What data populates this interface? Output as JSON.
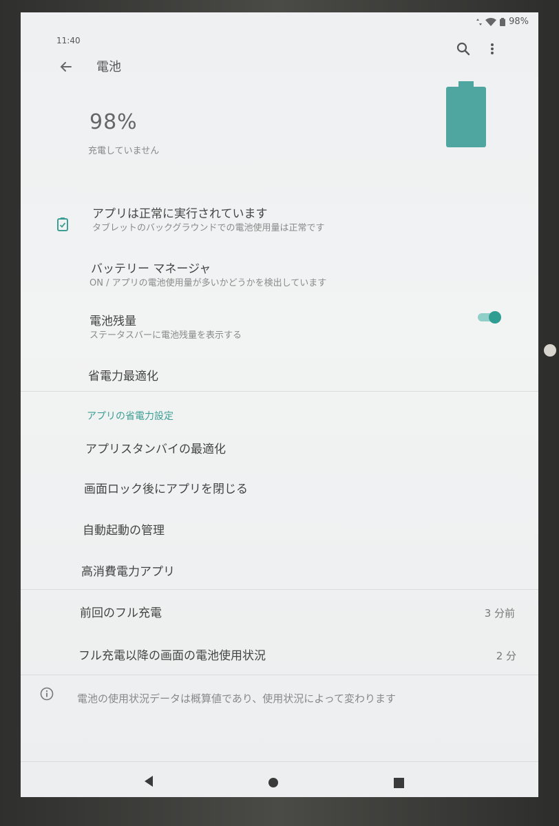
{
  "status": {
    "time": "11:40",
    "battery": "98%"
  },
  "appbar": {
    "title": "電池"
  },
  "header": {
    "percent": "98%",
    "charging_status": "充電していません"
  },
  "items": [
    {
      "title": "アプリは正常に実行されています",
      "subtitle": "タブレットのバックグラウンドでの電池使用量は正常です"
    },
    {
      "title": "バッテリー マネージャ",
      "subtitle": "ON / アプリの電池使用量が多いかどうかを検出しています"
    },
    {
      "title": "電池残量",
      "subtitle": "ステータスバーに電池残量を表示する",
      "toggle_on": true
    },
    {
      "title": "省電力最適化"
    }
  ],
  "section": {
    "header": "アプリの省電力設定"
  },
  "app_items": [
    {
      "title": "アプリスタンバイの最適化"
    },
    {
      "title": "画面ロック後にアプリを閉じる"
    },
    {
      "title": "自動起動の管理"
    },
    {
      "title": "高消費電力アプリ"
    }
  ],
  "stats": [
    {
      "title": "前回のフル充電",
      "value": "3 分前"
    },
    {
      "title": "フル充電以降の画面の電池使用状況",
      "value": "2 分"
    }
  ],
  "footer": {
    "note": "電池の使用状況データは概算値であり、使用状況によって変わります"
  },
  "colors": {
    "accent": "#3c9e94",
    "battery_fill": "#4fa6a0"
  },
  "icons": {
    "back": "arrow-left-icon",
    "search": "search-icon",
    "more": "more-vert-icon",
    "battery": "battery-icon",
    "battery_check": "battery-check-icon",
    "info": "info-icon"
  }
}
